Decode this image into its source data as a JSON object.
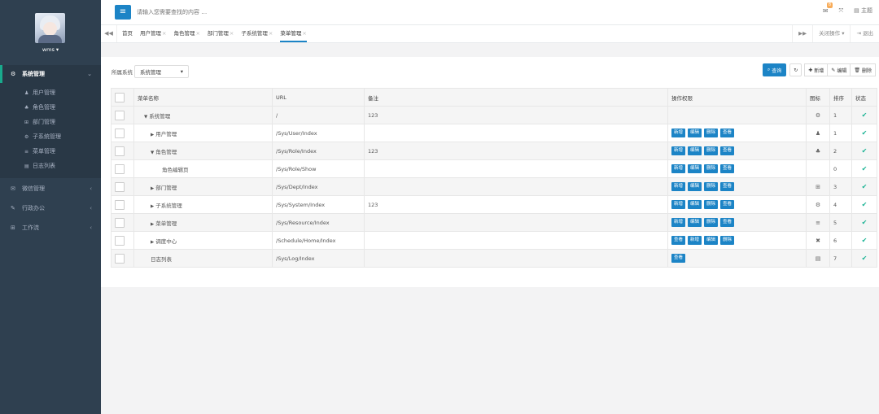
{
  "user": {
    "name": "wms ▾"
  },
  "sidebar": {
    "groups": [
      {
        "label": "系统管理",
        "icon": "⚙",
        "arrow": "⌄"
      },
      {
        "label": "微信管理",
        "icon": "✉",
        "arrow": "‹"
      },
      {
        "label": "行政办公",
        "icon": "✎",
        "arrow": "‹"
      },
      {
        "label": "工作流",
        "icon": "⊞",
        "arrow": "‹"
      }
    ],
    "sub_items": [
      {
        "label": "用户管理",
        "icon": "♟"
      },
      {
        "label": "角色管理",
        "icon": "♣"
      },
      {
        "label": "部门管理",
        "icon": "⊞"
      },
      {
        "label": "子系统管理",
        "icon": "⚙"
      },
      {
        "label": "菜单管理",
        "icon": "≡"
      },
      {
        "label": "日志列表",
        "icon": "▤"
      }
    ]
  },
  "topbar": {
    "search_placeholder": "请输入您需要查找的内容 …",
    "mail_badge": "8",
    "theme_label": "主题"
  },
  "tabs": {
    "items": [
      "首页",
      "用户管理",
      "角色管理",
      "部门管理",
      "子系统管理",
      "菜单管理"
    ],
    "close_ops": "关闭操作 ▾",
    "exit": "退出"
  },
  "filter": {
    "label": "所属系统",
    "value": "系统管理"
  },
  "toolbar": {
    "search": "查询",
    "add": "新增",
    "edit": "编辑",
    "delete": "删除"
  },
  "table": {
    "headers": [
      "菜单名称",
      "URL",
      "备注",
      "操作权限",
      "图标",
      "排序",
      "状态"
    ],
    "rows": [
      {
        "name": "系统管理",
        "url": "/",
        "remark": "123",
        "ops": [],
        "icon": "⚙",
        "sort": "1",
        "level": 0,
        "caret": "▼"
      },
      {
        "name": "用户管理",
        "url": "/Sys/User/Index",
        "remark": "",
        "ops": [
          "新增",
          "编辑",
          "删除",
          "查看"
        ],
        "icon": "♟",
        "sort": "1",
        "level": 1,
        "caret": "▶"
      },
      {
        "name": "角色管理",
        "url": "/Sys/Role/Index",
        "remark": "123",
        "ops": [
          "新增",
          "编辑",
          "删除",
          "查看"
        ],
        "icon": "♣",
        "sort": "2",
        "level": 1,
        "caret": "▼"
      },
      {
        "name": "角色编辑页",
        "url": "/Sys/Role/Show",
        "remark": "",
        "ops": [
          "新增",
          "编辑",
          "删除",
          "查看"
        ],
        "icon": "",
        "sort": "0",
        "level": 2,
        "caret": ""
      },
      {
        "name": "部门管理",
        "url": "/Sys/Dept/Index",
        "remark": "",
        "ops": [
          "新增",
          "编辑",
          "删除",
          "查看"
        ],
        "icon": "⊞",
        "sort": "3",
        "level": 1,
        "caret": "▶"
      },
      {
        "name": "子系统管理",
        "url": "/Sys/System/Index",
        "remark": "123",
        "ops": [
          "新增",
          "编辑",
          "删除",
          "查看"
        ],
        "icon": "⚙",
        "sort": "4",
        "level": 1,
        "caret": "▶"
      },
      {
        "name": "菜单管理",
        "url": "/Sys/Resource/Index",
        "remark": "",
        "ops": [
          "新增",
          "编辑",
          "删除",
          "查看"
        ],
        "icon": "≡",
        "sort": "5",
        "level": 1,
        "caret": "▶"
      },
      {
        "name": "调度中心",
        "url": "/Schedule/Home/Index",
        "remark": "",
        "ops": [
          "查看",
          "新增",
          "编辑",
          "删除"
        ],
        "icon": "✖",
        "sort": "6",
        "level": 1,
        "caret": "▶"
      },
      {
        "name": "日志列表",
        "url": "/Sys/Log/Index",
        "remark": "",
        "ops": [
          "查看"
        ],
        "icon": "▤",
        "sort": "7",
        "level": 1,
        "caret": ""
      }
    ],
    "status_icon": "✔"
  }
}
